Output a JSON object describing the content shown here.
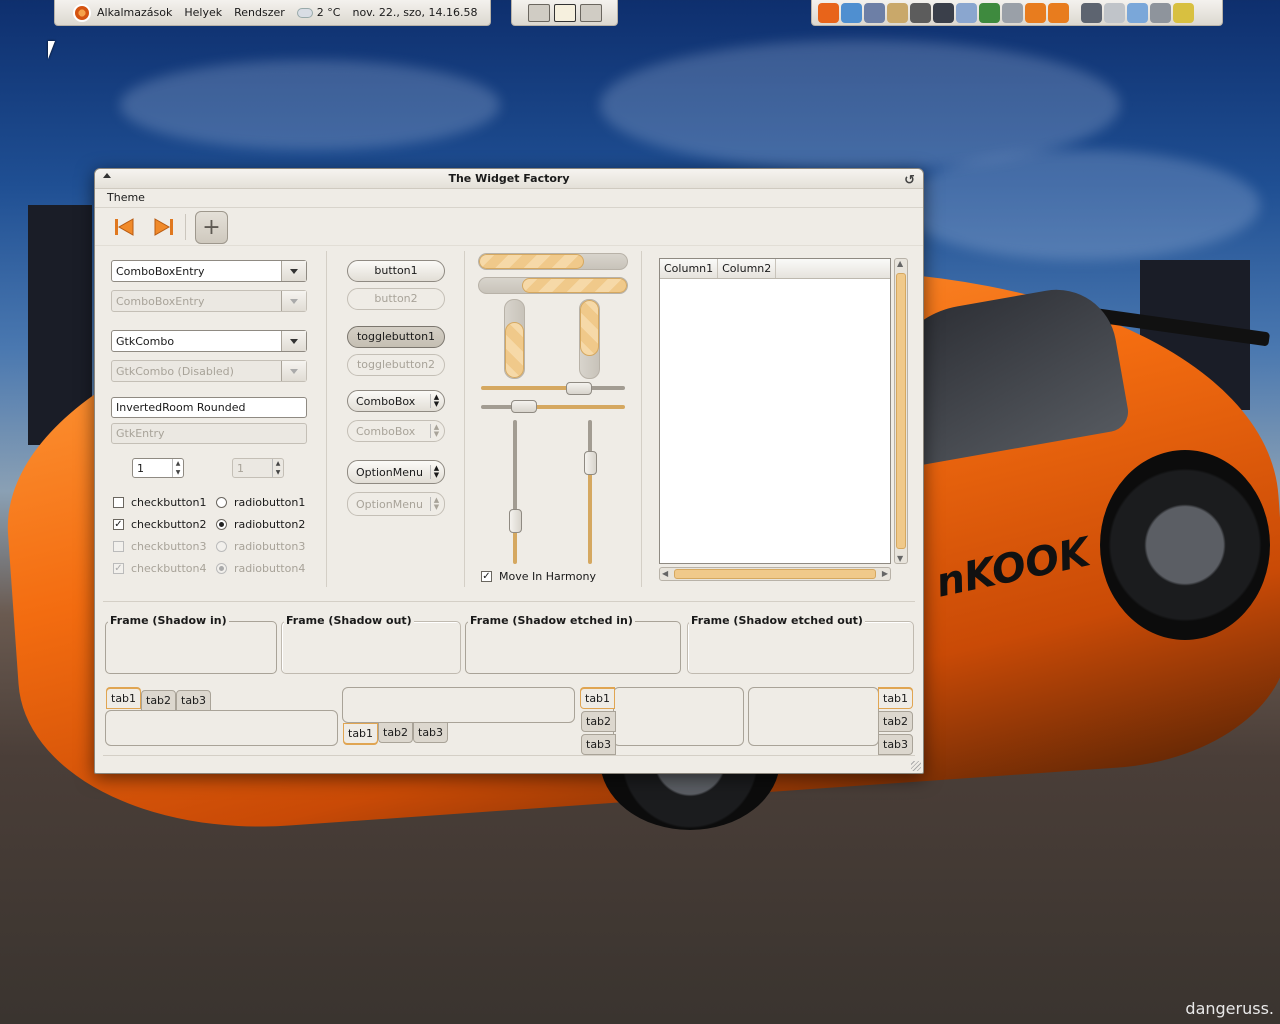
{
  "top_panel": {
    "menu": [
      "Alkalmazások",
      "Helyek",
      "Rendszer"
    ],
    "weather": "2 °C",
    "clock": "nov. 22., szo, 14.16.58",
    "tray_icons": [
      "firefox-icon",
      "contacts-icon",
      "network-icon",
      "archive-icon",
      "calculator-icon",
      "terminal-icon",
      "editor-icon",
      "monitor-icon",
      "disk-icon",
      "download-icon",
      "upload-icon",
      "screen-icon",
      "sound-icon",
      "user-icon",
      "volume-icon",
      "battery-icon"
    ],
    "tray_colors": [
      "#e8641a",
      "#4f8fd0",
      "#6d7fa6",
      "#c9a86a",
      "#5c5c5c",
      "#3a3f4a",
      "#8aa6cf",
      "#3e8a3e",
      "#9aa0a8",
      "#e87c1e",
      "#e87c1e",
      "#5d6470",
      "#c0c4c9",
      "#7aa7d9",
      "#8e949c",
      "#d8c040"
    ]
  },
  "window": {
    "title": "The Widget Factory",
    "menu": "Theme",
    "column1": {
      "combo_entry": "ComboBoxEntry",
      "combo_entry_disabled": "ComboBoxEntry",
      "gtk_combo": "GtkCombo",
      "gtk_combo_disabled": "GtkCombo (Disabled)",
      "entry": "InvertedRoom Rounded",
      "entry_disabled": "GtkEntry",
      "spin_value": "1",
      "spin_disabled_value": "1",
      "checks": [
        "checkbutton1",
        "checkbutton2",
        "checkbutton3",
        "checkbutton4"
      ],
      "radios": [
        "radiobutton1",
        "radiobutton2",
        "radiobutton3",
        "radiobutton4"
      ]
    },
    "column2": {
      "button1": "button1",
      "button2": "button2",
      "toggle1": "togglebutton1",
      "toggle2": "togglebutton2",
      "combobox": "ComboBox",
      "combobox_disabled": "ComboBox",
      "optionmenu": "OptionMenu",
      "optionmenu_disabled": "OptionMenu"
    },
    "column3": {
      "move_in_harmony": "Move In Harmony",
      "progress_h1": 0.7,
      "progress_h2": 0.7,
      "progress_v1": 0.7,
      "progress_v2": 0.7,
      "scale_h1": 0.68,
      "scale_h2": 0.3,
      "scale_v1": 0.7,
      "scale_v2": 0.3
    },
    "tree": {
      "columns": [
        "Column1",
        "Column2"
      ]
    },
    "frames": [
      "Frame (Shadow in)",
      "Frame (Shadow out)",
      "Frame (Shadow etched in)",
      "Frame (Shadow etched out)"
    ],
    "tabs": [
      "tab1",
      "tab2",
      "tab3"
    ]
  },
  "watermark": "dangeruss."
}
